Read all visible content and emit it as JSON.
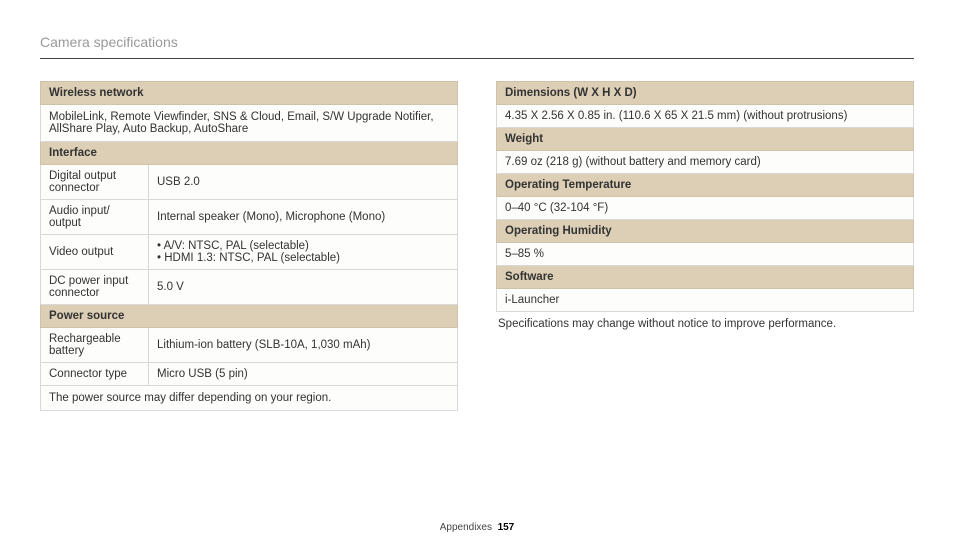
{
  "title": "Camera specifications",
  "left": {
    "wireless": {
      "header": "Wireless network",
      "value": "MobileLink, Remote Viewfinder, SNS & Cloud, Email, S/W Upgrade Notifier, AllShare Play, Auto Backup, AutoShare"
    },
    "interface": {
      "header": "Interface",
      "rows": {
        "digital_output": {
          "label": "Digital output connector",
          "value": "USB 2.0"
        },
        "audio_io": {
          "label": "Audio input/ output",
          "value": "Internal speaker (Mono), Microphone (Mono)"
        },
        "video_output": {
          "label": "Video output",
          "list": {
            "a": "A/V: NTSC, PAL (selectable)",
            "b": "HDMI 1.3: NTSC, PAL (selectable)"
          }
        },
        "dc_power": {
          "label": "DC power input connector",
          "value": "5.0 V"
        }
      }
    },
    "power": {
      "header": "Power source",
      "rows": {
        "battery": {
          "label": "Rechargeable battery",
          "value": "Lithium-ion battery (SLB-10A, 1,030 mAh)"
        },
        "connector": {
          "label": "Connector type",
          "value": "Micro USB (5 pin)"
        }
      },
      "note": "The power source may differ depending on your region."
    }
  },
  "right": {
    "dimensions": {
      "header": "Dimensions (W X H X D)",
      "value": "4.35 X 2.56 X 0.85 in. (110.6 X 65 X 21.5 mm) (without protrusions)"
    },
    "weight": {
      "header": "Weight",
      "value": "7.69 oz (218 g) (without battery and memory card)"
    },
    "op_temp": {
      "header": "Operating Temperature",
      "value": "0–40 °C (32-104 °F)"
    },
    "op_humidity": {
      "header": "Operating Humidity",
      "value": "5–85 %"
    },
    "software": {
      "header": "Software",
      "value": "i-Launcher"
    },
    "disclaimer": "Specifications may change without notice to improve performance."
  },
  "footer": {
    "section": "Appendixes",
    "page": "157"
  }
}
